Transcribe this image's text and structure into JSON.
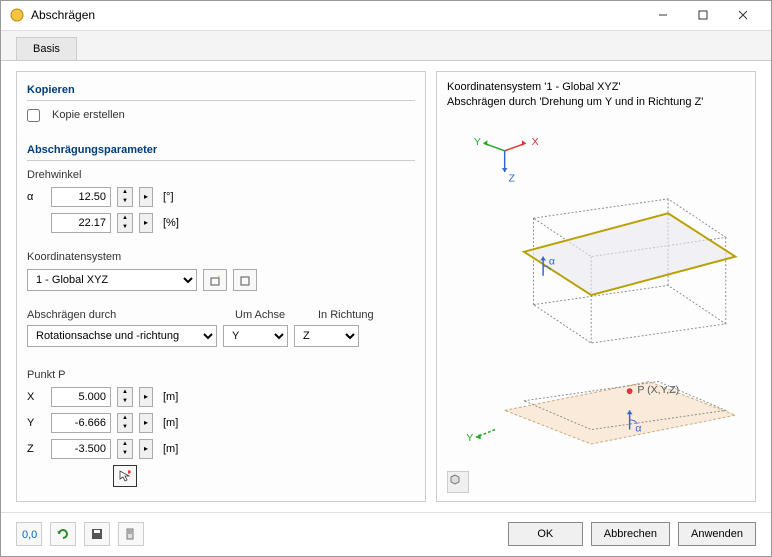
{
  "window": {
    "title": "Abschrägen"
  },
  "tabs": {
    "basis": "Basis"
  },
  "sections": {
    "kopieren": "Kopieren",
    "params": "Abschrägungsparameter"
  },
  "copy": {
    "label": "Kopie erstellen"
  },
  "angle": {
    "label": "Drehwinkel",
    "alpha": "α",
    "deg_value": "12.50",
    "deg_unit": "[°]",
    "pct_value": "22.17",
    "pct_unit": "[%]"
  },
  "coord": {
    "label": "Koordinatensystem",
    "value": "1 - Global XYZ"
  },
  "skew": {
    "label": "Abschrägen durch",
    "axis_label": "Um Achse",
    "dir_label": "In Richtung",
    "method": "Rotationsachse und -richtung",
    "axis": "Y",
    "direction": "Z"
  },
  "point": {
    "label": "Punkt P",
    "x": "X",
    "x_val": "5.000",
    "y": "Y",
    "y_val": "-6.666",
    "z": "Z",
    "z_val": "-3.500",
    "unit": "[m]"
  },
  "preview": {
    "line1": "Koordinatensystem '1 - Global XYZ'",
    "line2": "Abschrägen durch 'Drehung um Y und in Richtung Z'",
    "ax_x": "X",
    "ax_y": "Y",
    "ax_z": "Z",
    "alpha": "α",
    "p_label": "P (X,Y,Z)"
  },
  "buttons": {
    "ok": "OK",
    "cancel": "Abbrechen",
    "apply": "Anwenden"
  }
}
